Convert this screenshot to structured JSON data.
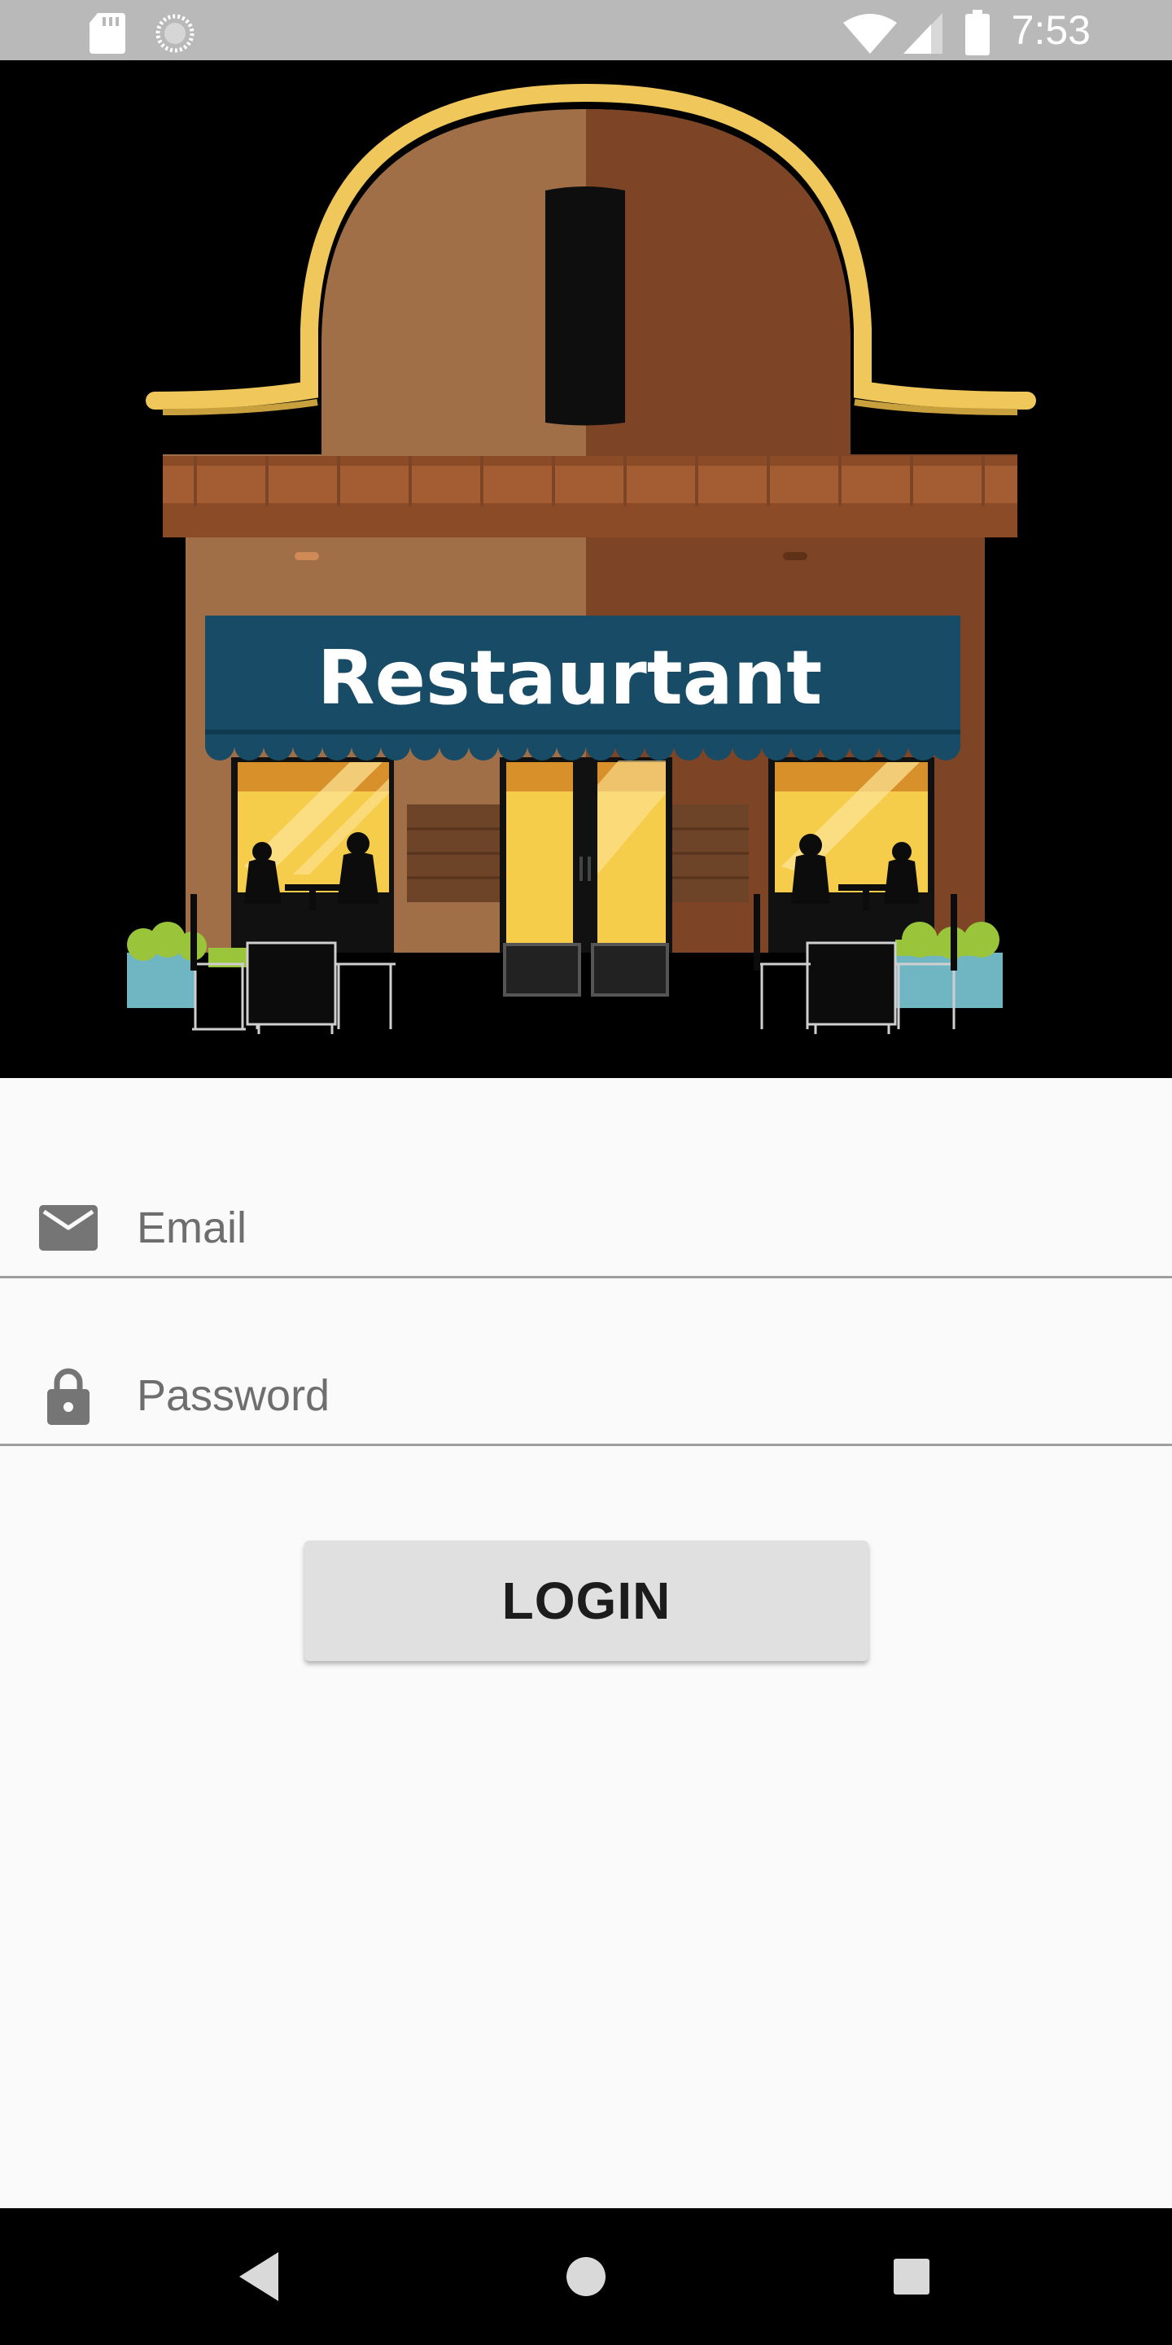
{
  "status_bar": {
    "time": "7:53",
    "icons": [
      "sd-card-icon",
      "sync-icon",
      "wifi-icon",
      "cell-signal-icon",
      "battery-icon"
    ]
  },
  "hero": {
    "sign_text": "Restaurtant",
    "awning_color": "#174b66",
    "roof_trim_color": "#f0c75a",
    "wall_color_left": "#a06f48",
    "wall_color_right": "#7d4526"
  },
  "form": {
    "email": {
      "placeholder": "Email",
      "value": "",
      "icon": "email-icon"
    },
    "password": {
      "placeholder": "Password",
      "value": "",
      "icon": "lock-icon"
    },
    "login_label": "LOGIN"
  },
  "nav_bar": {
    "buttons": [
      "back-icon",
      "home-icon",
      "recents-icon"
    ]
  },
  "colors": {
    "background": "#fafafa",
    "status_bar": "#b9b9b9",
    "button": "#e0e0e0",
    "field_text": "#6e6e6e",
    "divider": "#9e9e9e"
  }
}
